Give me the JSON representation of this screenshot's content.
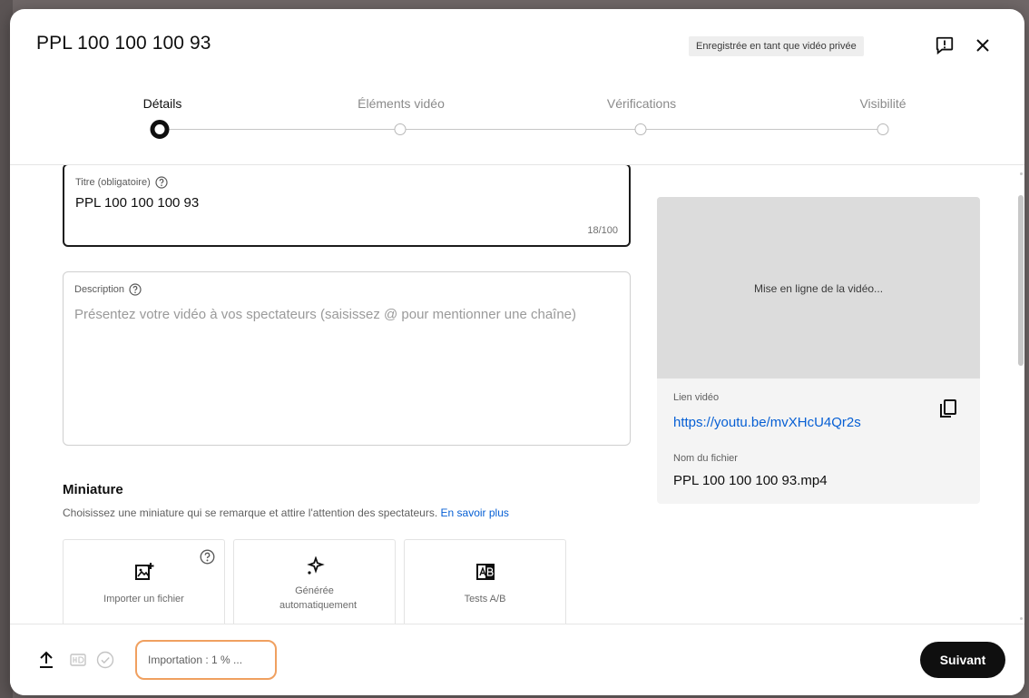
{
  "header": {
    "title": "PPL 100 100 100 93",
    "saved_badge": "Enregistrée en tant que vidéo privée"
  },
  "stepper": {
    "steps": [
      {
        "label": "Détails",
        "active": true
      },
      {
        "label": "Éléments vidéo",
        "active": false
      },
      {
        "label": "Vérifications",
        "active": false
      },
      {
        "label": "Visibilité",
        "active": false
      }
    ]
  },
  "details": {
    "title_field": {
      "label": "Titre (obligatoire)",
      "value": "PPL 100 100 100 93",
      "counter": "18/100"
    },
    "description_field": {
      "label": "Description",
      "placeholder": "Présentez votre vidéo à vos spectateurs (saisissez @ pour mentionner une chaîne)"
    },
    "thumbnail": {
      "title": "Miniature",
      "subtitle": "Choisissez une miniature qui se remarque et attire l'attention des spectateurs.",
      "learn_more": "En savoir plus",
      "options": [
        {
          "label": "Importer un fichier",
          "icon": "add-photo-icon"
        },
        {
          "label": "Générée automatiquement",
          "icon": "sparkle-icon"
        },
        {
          "label": "Tests A/B",
          "icon": "ab-test-icon"
        }
      ]
    }
  },
  "video_panel": {
    "preview_text": "Mise en ligne de la vidéo...",
    "link_label": "Lien vidéo",
    "link": "https://youtu.be/mvXHcU4Qr2s",
    "file_label": "Nom du fichier",
    "file_name": "PPL 100 100 100 93.mp4"
  },
  "footer": {
    "status": "Importation : 1 % ...",
    "next_label": "Suivant"
  },
  "colors": {
    "link": "#065fd4",
    "status_outline": "#f0a060",
    "primary_button": "#0f0f0f"
  }
}
